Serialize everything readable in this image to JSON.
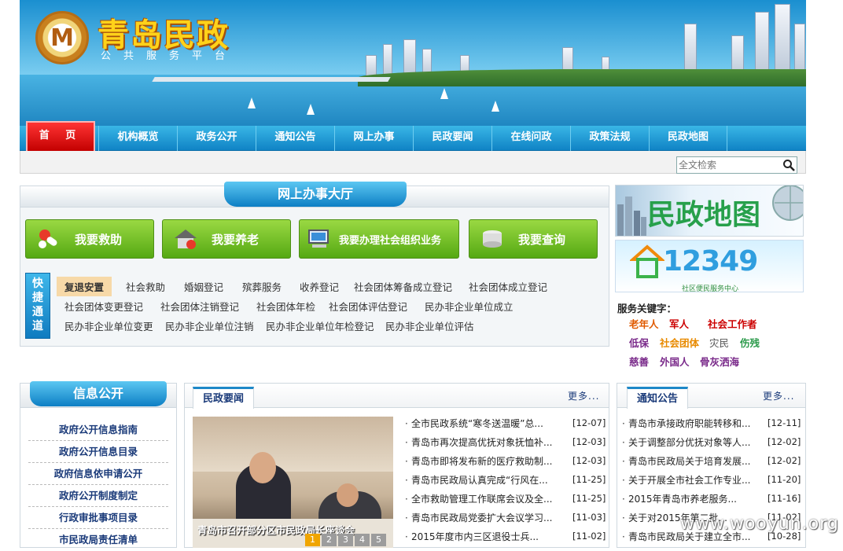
{
  "header": {
    "site_title": "青岛民政",
    "site_subtitle": "公共服务平台"
  },
  "nav": {
    "items": [
      "首 页",
      "机构概览",
      "政务公开",
      "通知公告",
      "网上办事",
      "民政要闻",
      "在线问政",
      "政策法规",
      "民政地图"
    ]
  },
  "search": {
    "placeholder": "全文检索"
  },
  "hall": {
    "title": "网上办事大厅",
    "buttons": [
      "我要救助",
      "我要养老",
      "我要办理社会组织业务",
      "我要查询"
    ],
    "quick_tag": "快捷通道",
    "quick_links": [
      [
        "复退安置",
        "社会救助",
        "婚姻登记",
        "殡葬服务",
        "收养登记",
        "社会团体筹备成立登记",
        "社会团体成立登记"
      ],
      [
        "社会团体变更登记",
        "社会团体注销登记",
        "社会团体年检",
        "社会团体评估登记",
        "民办非企业单位成立"
      ],
      [
        "民办非企业单位变更",
        "民办非企业单位注销",
        "民办非企业单位年检登记",
        "民办非企业单位评估"
      ]
    ]
  },
  "right": {
    "map_ad": "民政地图",
    "hotline": "12349",
    "hotline_sub": "社区便民服务中心",
    "kw_title": "服务关键字：",
    "keywords": [
      [
        {
          "t": "老年人",
          "c": "#e05a00"
        },
        {
          "t": "军人",
          "c": "#cc0000"
        },
        {
          "t": "社会工作者",
          "c": "#cc0000"
        }
      ],
      [
        {
          "t": "低保",
          "c": "#7a2a8a"
        },
        {
          "t": "社会团体",
          "c": "#e88a00"
        },
        {
          "t": "灾民",
          "c": "#555555"
        },
        {
          "t": "伤残",
          "c": "#2a9a4a"
        }
      ],
      [
        {
          "t": "慈善",
          "c": "#7a2a8a"
        },
        {
          "t": "外国人",
          "c": "#7a2a8a"
        },
        {
          "t": "骨灰洒海",
          "c": "#7a2a8a"
        }
      ]
    ]
  },
  "info": {
    "title": "信息公开",
    "items": [
      "政府公开信息指南",
      "政府公开信息目录",
      "政府信息依申请公开",
      "政府公开制度制定",
      "行政审批事项目录",
      "市民政局责任清单"
    ]
  },
  "news": {
    "tab": "民政要闻",
    "more": "更多...",
    "photo_caption": "青岛市召开部分区市民政局长座谈会",
    "pages": [
      "1",
      "2",
      "3",
      "4",
      "5"
    ],
    "items": [
      {
        "t": "全市民政系统“寒冬送温暖”总...",
        "d": "[12-07]"
      },
      {
        "t": "青岛市再次提高优抚对象抚恤补...",
        "d": "[12-03]"
      },
      {
        "t": "青岛市即将发布新的医疗救助制...",
        "d": "[12-03]"
      },
      {
        "t": "青岛市民政局认真完成“行风在...",
        "d": "[11-25]"
      },
      {
        "t": "全市救助管理工作联席会议及全...",
        "d": "[11-25]"
      },
      {
        "t": "青岛市民政局党委扩大会议学习...",
        "d": "[11-03]"
      },
      {
        "t": "2015年度市内三区退役士兵...",
        "d": "[11-02]"
      }
    ]
  },
  "notice": {
    "tab": "通知公告",
    "more": "更多...",
    "items": [
      {
        "t": "青岛市承接政府职能转移和...",
        "d": "[12-11]"
      },
      {
        "t": "关于调整部分优抚对象等人...",
        "d": "[12-02]"
      },
      {
        "t": "青岛市民政局关于培育发展...",
        "d": "[12-02]"
      },
      {
        "t": "关于开展全市社会工作专业...",
        "d": "[11-20]"
      },
      {
        "t": "2015年青岛市养老服务...",
        "d": "[11-16]"
      },
      {
        "t": "关于对2015年第二批...",
        "d": "[11-02]"
      },
      {
        "t": "青岛市民政局关于建立全市...",
        "d": "[10-28]"
      }
    ]
  },
  "watermark": "www.wooyun.org"
}
